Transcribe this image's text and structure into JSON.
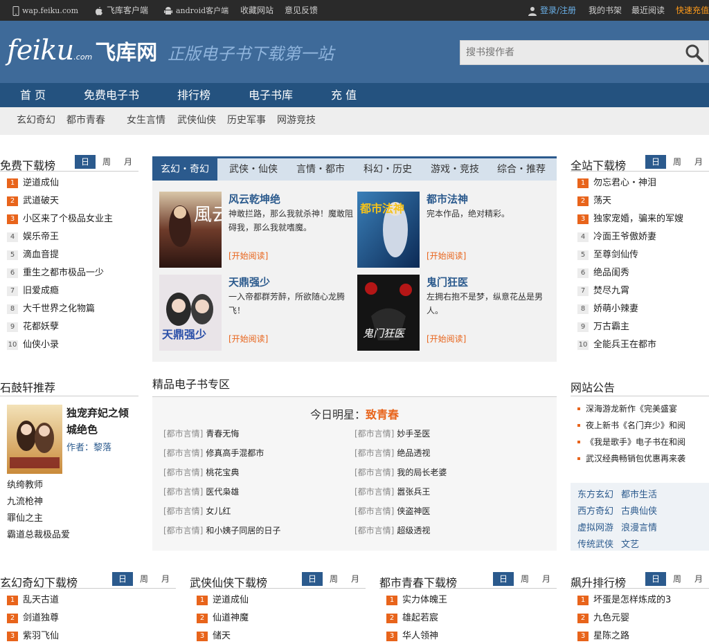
{
  "topbar": {
    "site": "wap.feiku.com",
    "ios": "飞库客户端",
    "android": "android客户端",
    "favorite": "收藏网站",
    "feedback": "意见反馈",
    "login": "登录/注册",
    "shelf": "我的书架",
    "recent": "最近阅读",
    "recharge": "快速充值"
  },
  "header": {
    "logo_text": "feiku",
    "logo_dotcom": ".com",
    "logo_cn": "飞库网",
    "slogan": "正版电子书下载第一站",
    "search_placeholder": "搜书搜作者"
  },
  "nav": [
    "首 页",
    "免费电子书",
    "排行榜",
    "电子书库",
    "充 值"
  ],
  "subnav": [
    "玄幻奇幻",
    "都市青春",
    "女生言情",
    "武侠仙侠",
    "历史军事",
    "网游竞技"
  ],
  "tabs_dwm": [
    "日",
    "周",
    "月"
  ],
  "free_dl": {
    "title": "免费下载榜",
    "items": [
      "逆道成仙",
      "武道破天",
      "小区来了个极品女业主",
      "娱乐帝王",
      "滴血音提",
      "重生之都市极品一少",
      "旧爱成瘾",
      "大千世界之化物篇",
      "花都妖孽",
      "仙侠小录"
    ]
  },
  "all_dl": {
    "title": "全站下载榜",
    "items": [
      "勿忘君心・神泪",
      "荡天",
      "独家宠婚，骗来的军嫂",
      "冷面王爷傲娇妻",
      "至尊剑仙传",
      "绝品闺秀",
      "焚尽九霄",
      "娇萌小辣妻",
      "万古霸主",
      "全能兵王在都市"
    ]
  },
  "center_tabs": [
    "玄幻・奇幻",
    "武侠・仙侠",
    "言情・都市",
    "科幻・历史",
    "游戏・竞技",
    "综合・推荐"
  ],
  "books": [
    {
      "title": "风云乾坤绝",
      "desc": "神敢拦路，那么我就杀神！魔敢阻碍我，那么我就嗜魔。",
      "read": "[开始阅读]",
      "cover_text": "風云"
    },
    {
      "title": "都市法神",
      "desc": "完本作品，绝对精彩。",
      "read": "[开始阅读]",
      "cover_text": "都市法神"
    },
    {
      "title": "天鼎强少",
      "desc": "一入帝都群芳醉，所欲随心龙腾飞！",
      "read": "[开始阅读]",
      "cover_text": "天鼎强少"
    },
    {
      "title": "鬼门狂医",
      "desc": "左拥右抱不是梦，纵意花丛是男人。",
      "read": "[开始阅读]",
      "cover_text": "鬼门狂医"
    }
  ],
  "sgx": {
    "title": "石鼓轩推荐",
    "book_title": "独宠弃妃之倾城绝色",
    "author_label": "作者：",
    "author": "黎落",
    "list": [
      "纨绔教师",
      "九流枪神",
      "罪仙之主",
      "霸道总裁极品爱"
    ]
  },
  "jp": {
    "title": "精品电子书专区",
    "star_label": "今日明星：",
    "star_name": "致青春",
    "cat": "[都市言情]",
    "left": [
      "青春无悔",
      "修真高手混都市",
      "桃花宝典",
      "医代枭雄",
      "女儿红",
      "和小姨子同居的日子"
    ],
    "right": [
      "妙手圣医",
      "绝品透视",
      "我的局长老婆",
      "嚣张兵王",
      "侠盗神医",
      "超级透视"
    ]
  },
  "notice": {
    "title": "网站公告",
    "items": [
      "深海游龙新作《完美盛宴",
      "夜上新书《名门弃少》和阅",
      "《我是歌手》电子书在和阅",
      "武汉经典畅销包优惠再来袭"
    ]
  },
  "catgrid": [
    "东方玄幻",
    "都市生活",
    "西方奇幻",
    "古典仙侠",
    "虚拟网游",
    "浪漫言情",
    "传统武侠",
    "文艺"
  ],
  "bottom": [
    {
      "title": "玄幻奇幻下载榜",
      "items": [
        "乱天古道",
        "剑道独尊",
        "紫羽飞仙"
      ]
    },
    {
      "title": "武侠仙侠下载榜",
      "items": [
        "逆道成仙",
        "仙道神魔",
        "储天"
      ]
    },
    {
      "title": "都市青春下载榜",
      "items": [
        "实力体魄王",
        "雄起若宸",
        "华人领神"
      ]
    },
    {
      "title": "飙升排行榜",
      "items": [
        "坏蛋是怎样炼成的3",
        "九色元婴",
        "星陈之路"
      ]
    }
  ],
  "colors": {
    "header": "#3e6a99",
    "nav": "#24527f",
    "accent": "#e8641b",
    "link": "#2b5a8d"
  }
}
